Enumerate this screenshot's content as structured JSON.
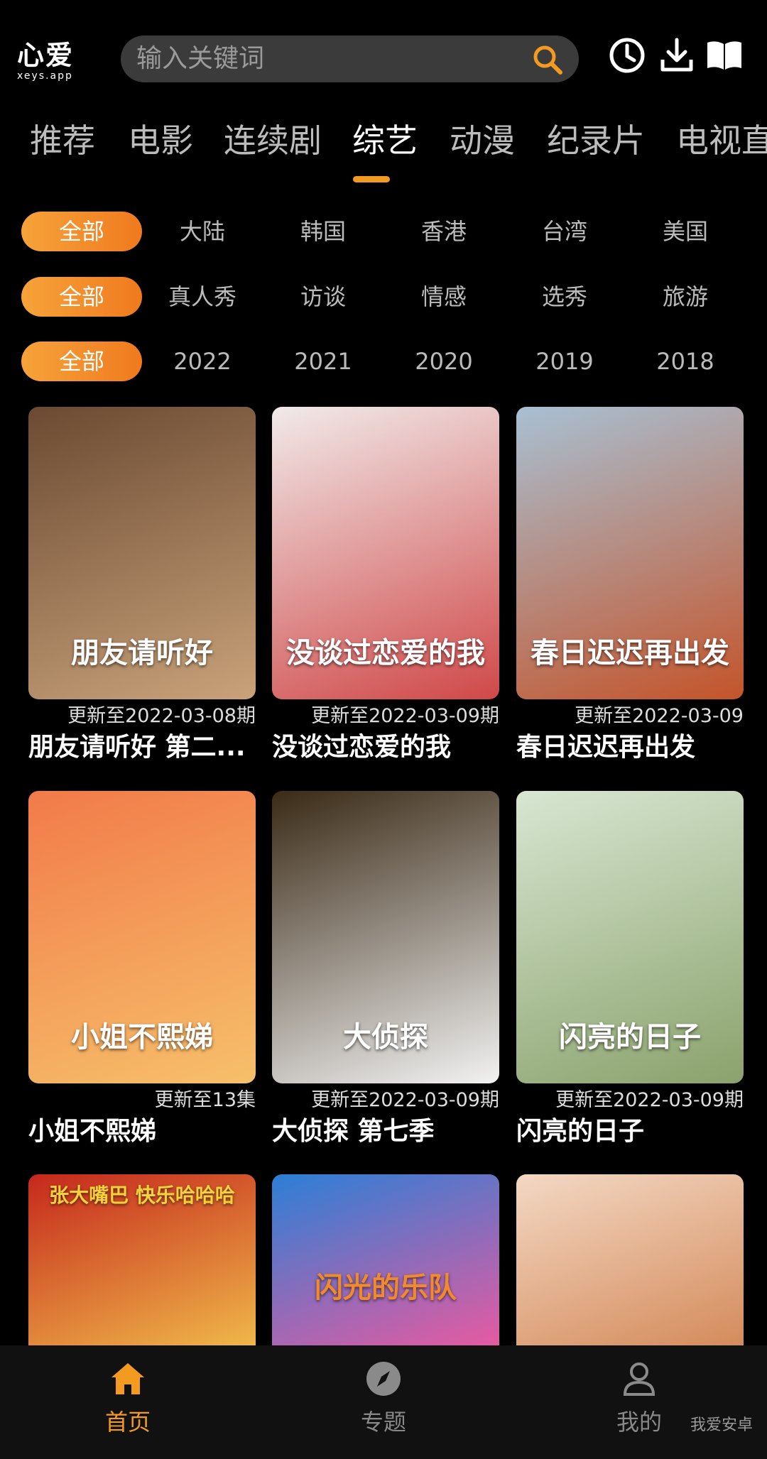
{
  "app": {
    "logo_main": "心爱",
    "logo_sub": "xeys.app"
  },
  "search": {
    "placeholder": "输入关键词"
  },
  "header_icons": [
    "history-icon",
    "download-icon",
    "book-icon"
  ],
  "categories": [
    {
      "label": "推荐"
    },
    {
      "label": "电影"
    },
    {
      "label": "连续剧"
    },
    {
      "label": "综艺",
      "active": true
    },
    {
      "label": "动漫"
    },
    {
      "label": "纪录片"
    },
    {
      "label": "电视直"
    }
  ],
  "filters": {
    "region": {
      "all": "全部",
      "options": [
        "大陆",
        "韩国",
        "香港",
        "台湾",
        "美国"
      ]
    },
    "genre": {
      "all": "全部",
      "options": [
        "真人秀",
        "访谈",
        "情感",
        "选秀",
        "旅游"
      ]
    },
    "year": {
      "all": "全部",
      "options": [
        "2022",
        "2021",
        "2020",
        "2019",
        "2018"
      ]
    }
  },
  "items": [
    {
      "title": "朋友请听好 第二...",
      "update": "更新至2022-03-08期",
      "poster_text": "朋友请听好",
      "colors": [
        "#6b4a32",
        "#c9a27a"
      ]
    },
    {
      "title": "没谈过恋爱的我",
      "update": "更新至2022-03-09期",
      "poster_text": "没谈过恋爱的我",
      "colors": [
        "#f1eaea",
        "#d04848"
      ]
    },
    {
      "title": "春日迟迟再出发",
      "update": "更新至2022-03-09",
      "poster_text": "春日迟迟再出发",
      "colors": [
        "#a8c0d3",
        "#c4542a"
      ]
    },
    {
      "title": "小姐不熙娣",
      "update": "更新至13集",
      "poster_text": "小姐不熙娣",
      "colors": [
        "#f27a4a",
        "#f6c06a"
      ]
    },
    {
      "title": "大侦探 第七季",
      "update": "更新至2022-03-09期",
      "poster_text": "大侦探",
      "colors": [
        "#3a2a16",
        "#f2f2f2"
      ]
    },
    {
      "title": "闪亮的日子",
      "update": "更新至2022-03-09期",
      "poster_text": "闪亮的日子",
      "colors": [
        "#d8e6d2",
        "#8aa26c"
      ]
    },
    {
      "poster_text": "张大嘴巴 快乐哈哈哈",
      "colors": [
        "#c5281c",
        "#f0b84a"
      ]
    },
    {
      "poster_text": "闪光的乐队",
      "colors": [
        "#2b7fd6",
        "#e85aa0"
      ]
    },
    {
      "poster_text": "",
      "colors": [
        "#f3d8c4",
        "#d48a5a"
      ]
    }
  ],
  "bottom_nav": [
    {
      "label": "首页",
      "icon": "home-icon",
      "active": true
    },
    {
      "label": "专题",
      "icon": "compass-icon"
    },
    {
      "label": "我的",
      "icon": "user-icon"
    }
  ],
  "watermark": "我爱安卓",
  "accent": "#f39b21"
}
